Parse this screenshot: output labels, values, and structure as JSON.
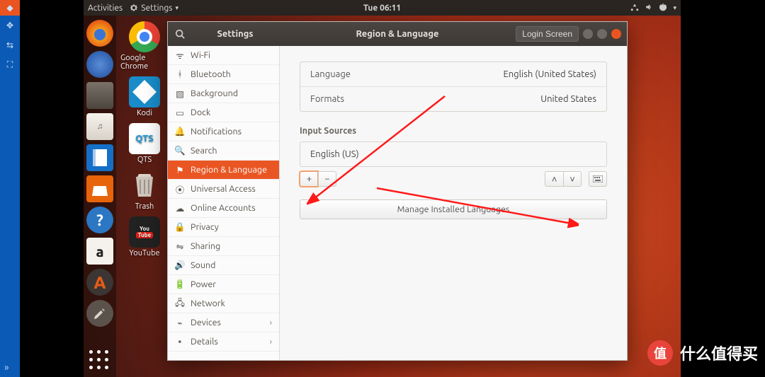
{
  "topbar": {
    "activities": "Activities",
    "app_indicator": "Settings",
    "clock": "Tue 06:11"
  },
  "desktop_icons": [
    {
      "label": "Google Chrome"
    },
    {
      "label": "Kodi"
    },
    {
      "label": "QTS"
    },
    {
      "label": "Trash"
    },
    {
      "label": "YouTube"
    }
  ],
  "window": {
    "app_title": "Settings",
    "page_title": "Region & Language",
    "login_button": "Login Screen"
  },
  "sidebar": {
    "items": [
      {
        "label": "Wi-Fi"
      },
      {
        "label": "Bluetooth"
      },
      {
        "label": "Background"
      },
      {
        "label": "Dock"
      },
      {
        "label": "Notifications"
      },
      {
        "label": "Search"
      },
      {
        "label": "Region & Language"
      },
      {
        "label": "Universal Access"
      },
      {
        "label": "Online Accounts"
      },
      {
        "label": "Privacy"
      },
      {
        "label": "Sharing"
      },
      {
        "label": "Sound"
      },
      {
        "label": "Power"
      },
      {
        "label": "Network"
      },
      {
        "label": "Devices"
      },
      {
        "label": "Details"
      }
    ]
  },
  "content": {
    "language_label": "Language",
    "language_value": "English (United States)",
    "formats_label": "Formats",
    "formats_value": "United States",
    "input_sources_label": "Input Sources",
    "input_source_0": "English (US)",
    "add_label": "+",
    "remove_label": "−",
    "up_label": "˄",
    "down_label": "˅",
    "manage_button": "Manage Installed Languages"
  },
  "watermark": {
    "badge": "值",
    "text": "什么值得买"
  }
}
